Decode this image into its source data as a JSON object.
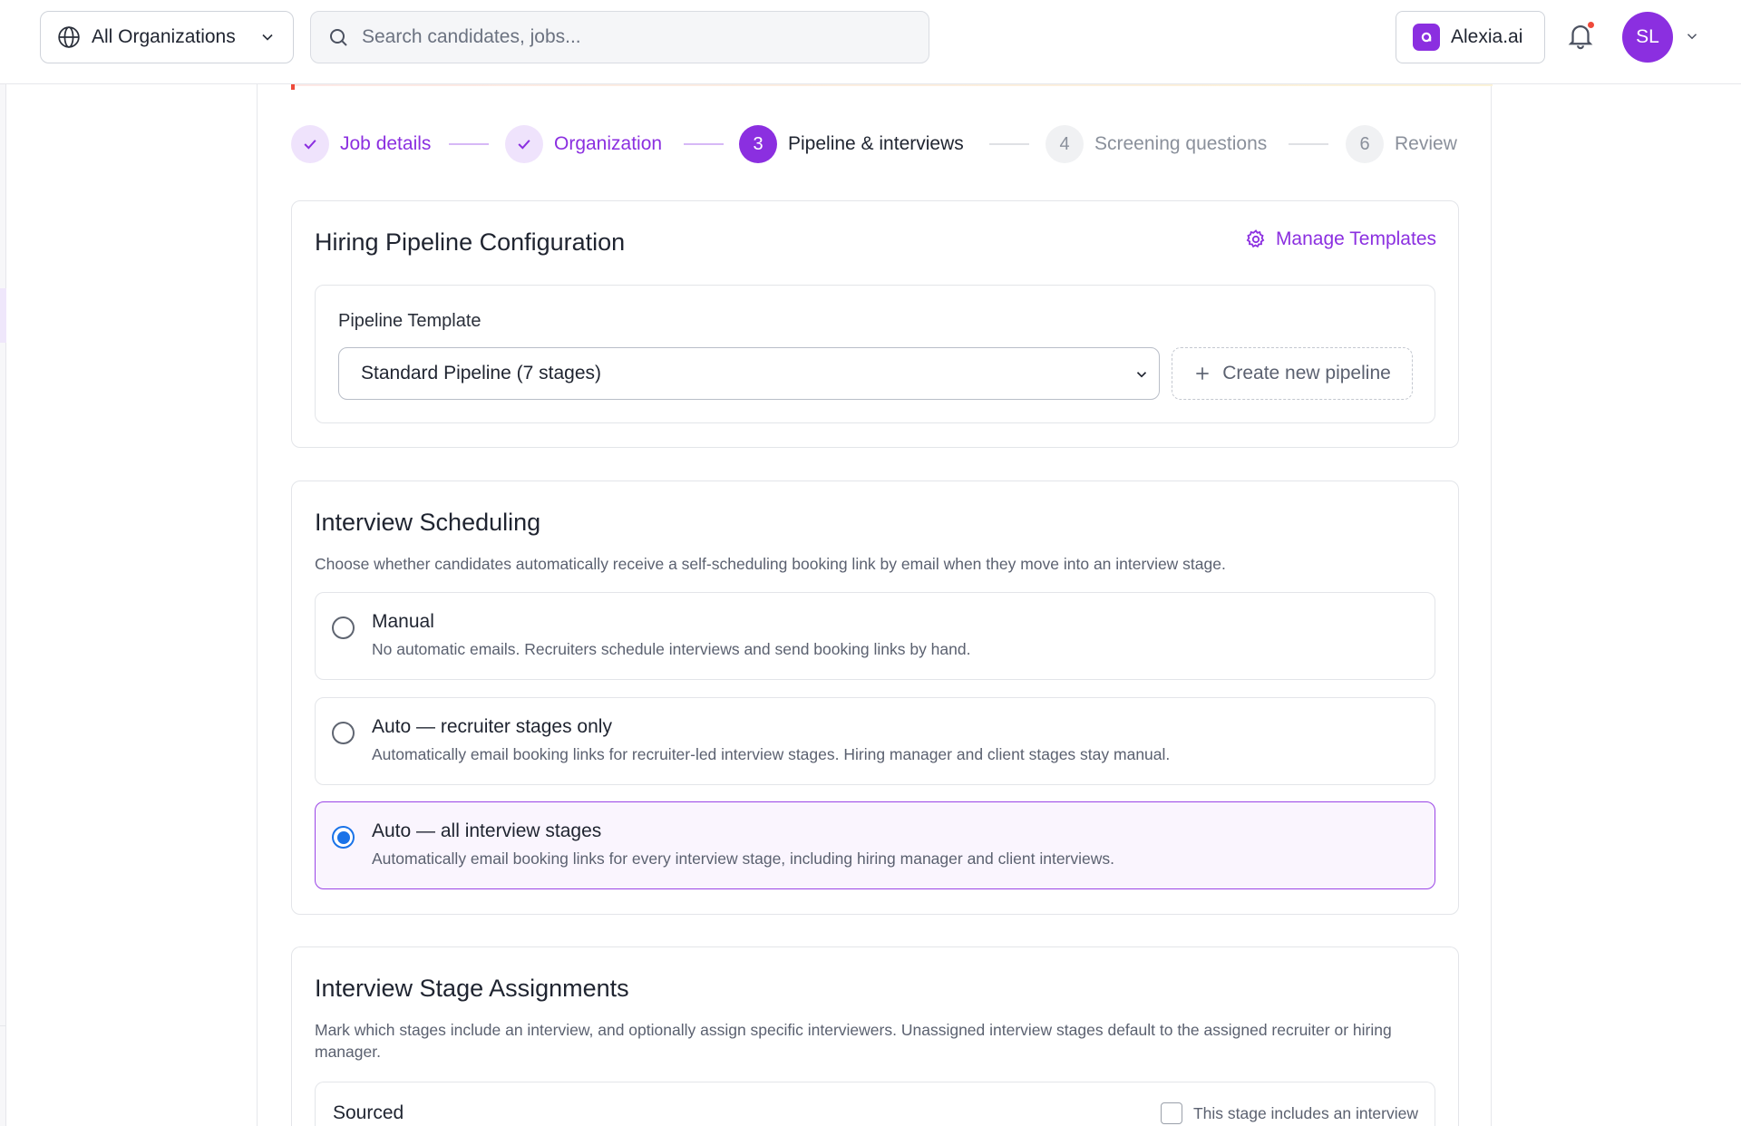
{
  "topbar": {
    "org_selector": "All Organizations",
    "search_placeholder": "Search candidates, jobs...",
    "assistant_label": "Alexia.ai",
    "avatar_initials": "SL"
  },
  "stepper": {
    "steps": [
      {
        "number": "",
        "label": "Job details",
        "state": "done"
      },
      {
        "number": "",
        "label": "Organization",
        "state": "done"
      },
      {
        "number": "3",
        "label": "Pipeline & interviews",
        "state": "active"
      },
      {
        "number": "4",
        "label": "Screening questions",
        "state": "todo"
      },
      {
        "number": "6",
        "label": "Review",
        "state": "todo"
      }
    ]
  },
  "pipeline_config": {
    "title": "Hiring Pipeline Configuration",
    "manage_templates": "Manage Templates",
    "template_label": "Pipeline Template",
    "template_value": "Standard Pipeline (7 stages)",
    "create_button": "Create new pipeline"
  },
  "scheduling": {
    "title": "Interview Scheduling",
    "description": "Choose whether candidates automatically receive a self-scheduling booking link by email when they move into an interview stage.",
    "options": [
      {
        "title": "Manual",
        "description": "No automatic emails. Recruiters schedule interviews and send booking links by hand.",
        "selected": false
      },
      {
        "title": "Auto — recruiter stages only",
        "description": "Automatically email booking links for recruiter-led interview stages. Hiring manager and client stages stay manual.",
        "selected": false
      },
      {
        "title": "Auto — all interview stages",
        "description": "Automatically email booking links for every interview stage, including hiring manager and client interviews.",
        "selected": true
      }
    ]
  },
  "stage_assignments": {
    "title": "Interview Stage Assignments",
    "description": "Mark which stages include an interview, and optionally assign specific interviewers. Unassigned interview stages default to the assigned recruiter or hiring manager.",
    "stages": [
      {
        "name": "Sourced",
        "checkbox_label": "This stage includes an interview",
        "checked": false
      }
    ]
  },
  "colors": {
    "accent": "#8b2fe0",
    "accent_light": "#efe3fc",
    "radio_selected": "#1a73e8",
    "notification_dot": "#ef4a3a"
  }
}
